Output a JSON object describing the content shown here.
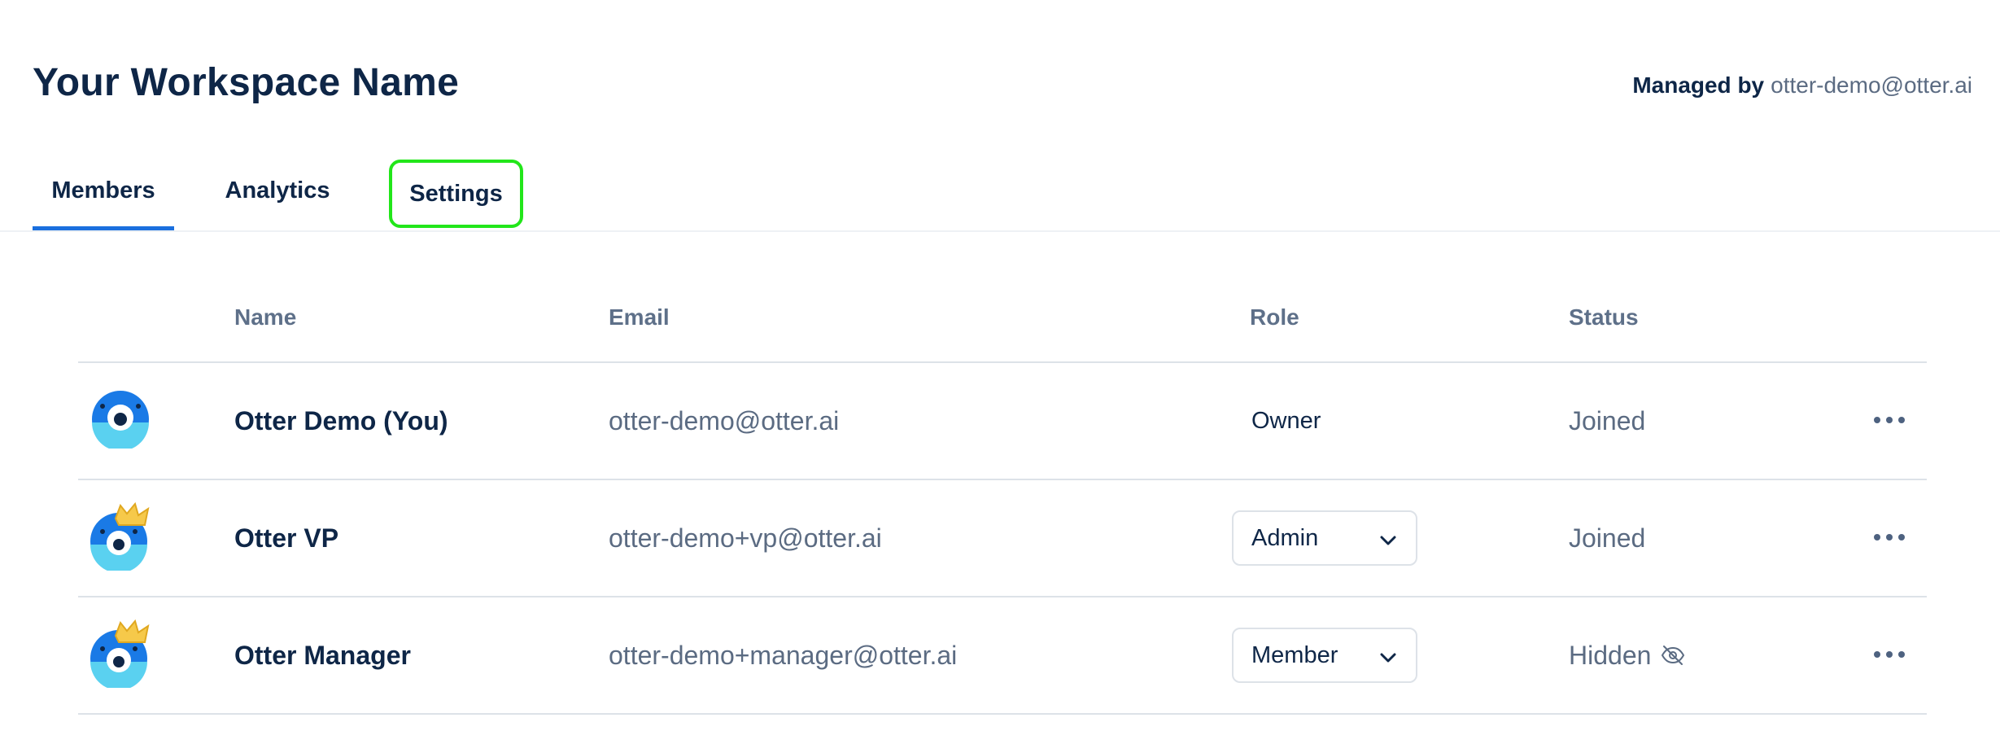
{
  "workspace": {
    "title": "Your Workspace Name",
    "managed_label": "Managed by",
    "managed_email": "otter-demo@otter.ai"
  },
  "tabs": [
    {
      "label": "Members",
      "active": true
    },
    {
      "label": "Analytics",
      "active": false
    },
    {
      "label": "Settings",
      "active": false,
      "highlighted": true
    }
  ],
  "table": {
    "headers": {
      "name": "Name",
      "email": "Email",
      "role": "Role",
      "status": "Status"
    },
    "rows": [
      {
        "name": "Otter Demo (You)",
        "email": "otter-demo@otter.ai",
        "role": "Owner",
        "role_editable": false,
        "status": "Joined",
        "avatar": "otter-avatar-icon"
      },
      {
        "name": "Otter VP",
        "email": "otter-demo+vp@otter.ai",
        "role": "Admin",
        "role_editable": true,
        "status": "Joined",
        "avatar": "otter-crown-avatar-icon"
      },
      {
        "name": "Otter Manager",
        "email": "otter-demo+manager@otter.ai",
        "role": "Member",
        "role_editable": true,
        "status": "Hidden",
        "status_icon": "eye-off-icon",
        "avatar": "otter-crown-avatar-icon"
      }
    ]
  },
  "colors": {
    "accent": "#1a6fde",
    "highlight": "#22e61a",
    "text_primary": "#0e2647",
    "text_secondary": "#5b6b82"
  }
}
